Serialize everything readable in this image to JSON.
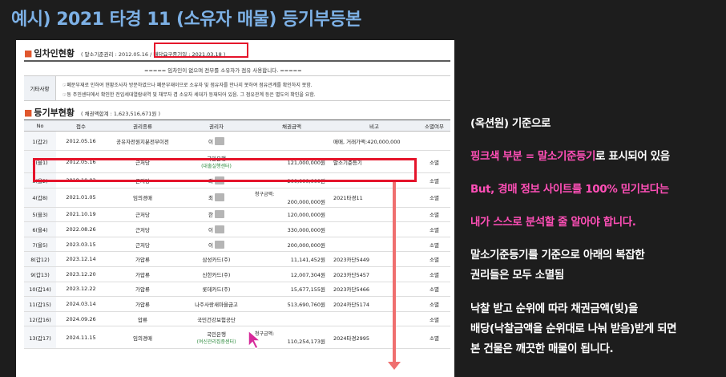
{
  "title": "예시) 2021 타경 11 (소유자 매물) 등기부등본",
  "lease_section": {
    "heading": "임차인현황",
    "sub_prefix": "( 말소기준권리 : 2012.05.16 / ",
    "highlight_text": "배당요구종기일 : 2021.03.18",
    "sub_suffix": " )",
    "notice": "===== 임차인이 없으며 전부를 소유자가 점유 사용합니다. =====",
    "etc_label": "기타사항",
    "etc_lines": [
      "☞폐문부재로 인하여 현황조사차 방문하였으나 폐문부재이므로 소유자 및 점유자를 만나지 못하여 점유관계를 확인하지 못함.",
      "☞동 주민센터에서 확인한 전입세대열람내역 및 채무자 겸 소유자 세대가 등재되어 있음. 그 점유관계 등은 별도의 확인을 요함."
    ]
  },
  "registry_section": {
    "heading": "등기부현황",
    "sub": "( 채권액합계 : 1,623,516,671원 )",
    "columns": [
      "No",
      "접수",
      "권리종류",
      "권리자",
      "채권금액",
      "비고",
      "소멸여부"
    ],
    "rows": [
      {
        "no": "1(갑2)",
        "date": "2012.05.16",
        "type": "공유자전원지분전부이전",
        "holder": "이",
        "holder_sub": "",
        "claim_label": "",
        "amount": "",
        "note": "매매, 거래가액:420,000,000",
        "status": ""
      },
      {
        "no": "2(을1)",
        "date": "2012.05.16",
        "type": "근저당",
        "holder": "국민은행",
        "holder_sub": "(대출실행센터)",
        "claim_label": "",
        "amount": "121,000,000원",
        "note": "말소기준등기",
        "status": "소멸"
      },
      {
        "no": "3(을2)",
        "date": "2018.10.02",
        "type": "근저당",
        "holder": "최",
        "holder_sub": "",
        "claim_label": "",
        "amount": "200,000,000원",
        "note": "",
        "status": "소멸"
      },
      {
        "no": "4(갑8)",
        "date": "2021.01.05",
        "type": "임의경매",
        "holder": "최",
        "holder_sub": "",
        "claim_label": "청구금액:",
        "amount": "200,000,000원",
        "note": "2021타경11",
        "status": "소멸"
      },
      {
        "no": "5(을3)",
        "date": "2021.10.19",
        "type": "근저당",
        "holder": "한",
        "holder_sub": "",
        "claim_label": "",
        "amount": "120,000,000원",
        "note": "",
        "status": "소멸"
      },
      {
        "no": "6(을4)",
        "date": "2022.08.26",
        "type": "근저당",
        "holder": "이",
        "holder_sub": "",
        "claim_label": "",
        "amount": "330,000,000원",
        "note": "",
        "status": "소멸"
      },
      {
        "no": "7(을5)",
        "date": "2023.03.15",
        "type": "근저당",
        "holder": "이",
        "holder_sub": "",
        "claim_label": "",
        "amount": "200,000,000원",
        "note": "",
        "status": "소멸"
      },
      {
        "no": "8(갑12)",
        "date": "2023.12.14",
        "type": "가압류",
        "holder": "삼성카드(주)",
        "holder_sub": "",
        "claim_label": "",
        "amount": "11,141,452원",
        "note": "2023카단5449",
        "status": "소멸"
      },
      {
        "no": "9(갑13)",
        "date": "2023.12.20",
        "type": "가압류",
        "holder": "신한카드(주)",
        "holder_sub": "",
        "claim_label": "",
        "amount": "12,007,304원",
        "note": "2023카단5457",
        "status": "소멸"
      },
      {
        "no": "10(갑14)",
        "date": "2023.12.22",
        "type": "가압류",
        "holder": "롯데카드(주)",
        "holder_sub": "",
        "claim_label": "",
        "amount": "15,677,155원",
        "note": "2023카단5466",
        "status": "소멸"
      },
      {
        "no": "11(갑15)",
        "date": "2024.03.14",
        "type": "가압류",
        "holder": "나주사랑새마을금고",
        "holder_sub": "",
        "claim_label": "",
        "amount": "513,690,760원",
        "note": "2024카단5174",
        "status": "소멸"
      },
      {
        "no": "12(갑16)",
        "date": "2024.09.26",
        "type": "압류",
        "holder": "국민건강보험공단",
        "holder_sub": "",
        "claim_label": "",
        "amount": "",
        "note": "",
        "status": "소멸"
      },
      {
        "no": "13(갑17)",
        "date": "2024.11.15",
        "type": "임의경매",
        "holder": "국민은행",
        "holder_sub": "(여신관리집중센터)",
        "claim_label": "청구금액:",
        "amount": "110,254,173원",
        "note": "2024타경2995",
        "status": "소멸"
      }
    ]
  },
  "right_panel": {
    "line1": "(옥션원) 기준으로",
    "line2_pink": "핑크색 부분 = 말소기준등기",
    "line2_white": "로 표시되어 있음",
    "line3": "But, 경매 정보 사이트를 100% 믿기보다는",
    "line4": "내가 스스로 분석할 줄 알아야 합니다.",
    "line5": "말소기준등기를 기준으로 아래의 복잡한",
    "line6": "권리들은 모두 소멸됨",
    "line7": "낙찰 받고 순위에 따라 채권금액(빚)을",
    "line8": "배당(낙찰금액을 순위대로 나눠 받음)받게 되면",
    "line9": "본 건물은 깨끗한 매물이 됩니다."
  },
  "colors": {
    "accent_title": "#7db1e6",
    "highlight_red": "#e5142b",
    "pink_text": "#ff4fb7",
    "arrow": "#ef6f6f"
  }
}
